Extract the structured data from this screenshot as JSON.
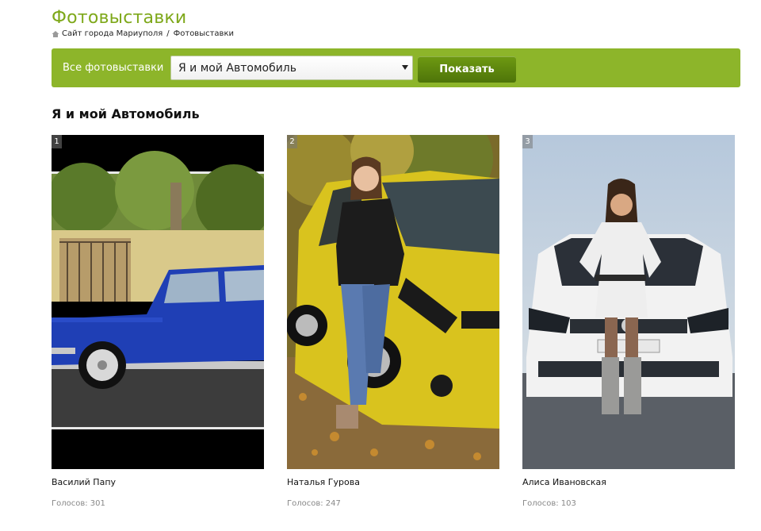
{
  "header": {
    "title": "Фотовыставки",
    "breadcrumb": {
      "home_icon": "home-icon",
      "site_link": "Сайт города Мариуполя",
      "separator": "/",
      "current": "Фотовыставки"
    }
  },
  "filter": {
    "label": "Все фотовыставки",
    "select_value": "Я и мой Автомобиль",
    "button_label": "Показать",
    "bar_color": "#8db52a",
    "button_color": "#5b8510"
  },
  "gallery": {
    "title": "Я и мой Автомобиль",
    "entries": [
      {
        "rank": "1",
        "author": "Василий Папу",
        "votes": "Голосов: 301"
      },
      {
        "rank": "2",
        "author": "Наталья Гурова",
        "votes": "Голосов: 247"
      },
      {
        "rank": "3",
        "author": "Алиса Ивановская",
        "votes": "Голосов: 103"
      }
    ]
  },
  "colors": {
    "accent": "#7ea81a"
  }
}
